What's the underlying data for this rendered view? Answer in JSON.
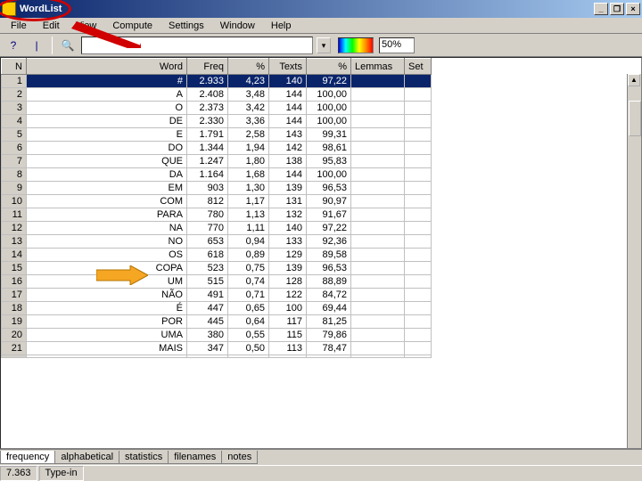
{
  "window": {
    "title": "WordList",
    "buttons": {
      "min": "_",
      "max": "❐",
      "close": "×"
    }
  },
  "menu": [
    "File",
    "Edit",
    "View",
    "Compute",
    "Settings",
    "Window",
    "Help"
  ],
  "toolbar": {
    "help": "?",
    "pipe": "|",
    "search_icon": "🔍",
    "search_value": "",
    "dropdown": "▾",
    "pct": "50%"
  },
  "columns": [
    "N",
    "Word",
    "Freq",
    "%",
    "Texts",
    "%",
    "Lemmas",
    "Set"
  ],
  "rows": [
    {
      "n": "1",
      "word": "#",
      "freq": "2.933",
      "pct": "4,23",
      "texts": "140",
      "pct2": "97,22"
    },
    {
      "n": "2",
      "word": "A",
      "freq": "2.408",
      "pct": "3,48",
      "texts": "144",
      "pct2": "100,00"
    },
    {
      "n": "3",
      "word": "O",
      "freq": "2.373",
      "pct": "3,42",
      "texts": "144",
      "pct2": "100,00"
    },
    {
      "n": "4",
      "word": "DE",
      "freq": "2.330",
      "pct": "3,36",
      "texts": "144",
      "pct2": "100,00"
    },
    {
      "n": "5",
      "word": "E",
      "freq": "1.791",
      "pct": "2,58",
      "texts": "143",
      "pct2": "99,31"
    },
    {
      "n": "6",
      "word": "DO",
      "freq": "1.344",
      "pct": "1,94",
      "texts": "142",
      "pct2": "98,61"
    },
    {
      "n": "7",
      "word": "QUE",
      "freq": "1.247",
      "pct": "1,80",
      "texts": "138",
      "pct2": "95,83"
    },
    {
      "n": "8",
      "word": "DA",
      "freq": "1.164",
      "pct": "1,68",
      "texts": "144",
      "pct2": "100,00"
    },
    {
      "n": "9",
      "word": "EM",
      "freq": "903",
      "pct": "1,30",
      "texts": "139",
      "pct2": "96,53"
    },
    {
      "n": "10",
      "word": "COM",
      "freq": "812",
      "pct": "1,17",
      "texts": "131",
      "pct2": "90,97"
    },
    {
      "n": "11",
      "word": "PARA",
      "freq": "780",
      "pct": "1,13",
      "texts": "132",
      "pct2": "91,67"
    },
    {
      "n": "12",
      "word": "NA",
      "freq": "770",
      "pct": "1,11",
      "texts": "140",
      "pct2": "97,22"
    },
    {
      "n": "13",
      "word": "NO",
      "freq": "653",
      "pct": "0,94",
      "texts": "133",
      "pct2": "92,36"
    },
    {
      "n": "14",
      "word": "OS",
      "freq": "618",
      "pct": "0,89",
      "texts": "129",
      "pct2": "89,58"
    },
    {
      "n": "15",
      "word": "COPA",
      "freq": "523",
      "pct": "0,75",
      "texts": "139",
      "pct2": "96,53"
    },
    {
      "n": "16",
      "word": "UM",
      "freq": "515",
      "pct": "0,74",
      "texts": "128",
      "pct2": "88,89"
    },
    {
      "n": "17",
      "word": "NÃO",
      "freq": "491",
      "pct": "0,71",
      "texts": "122",
      "pct2": "84,72"
    },
    {
      "n": "18",
      "word": "É",
      "freq": "447",
      "pct": "0,65",
      "texts": "100",
      "pct2": "69,44"
    },
    {
      "n": "19",
      "word": "POR",
      "freq": "445",
      "pct": "0,64",
      "texts": "117",
      "pct2": "81,25"
    },
    {
      "n": "20",
      "word": "UMA",
      "freq": "380",
      "pct": "0,55",
      "texts": "115",
      "pct2": "79,86"
    },
    {
      "n": "21",
      "word": "MAIS",
      "freq": "347",
      "pct": "0,50",
      "texts": "113",
      "pct2": "78,47"
    }
  ],
  "tabs": {
    "active": "frequency",
    "items": [
      "frequency",
      "alphabetical",
      "statistics",
      "filenames",
      "notes"
    ]
  },
  "status": {
    "count": "7.363",
    "mode": "Type-in"
  }
}
